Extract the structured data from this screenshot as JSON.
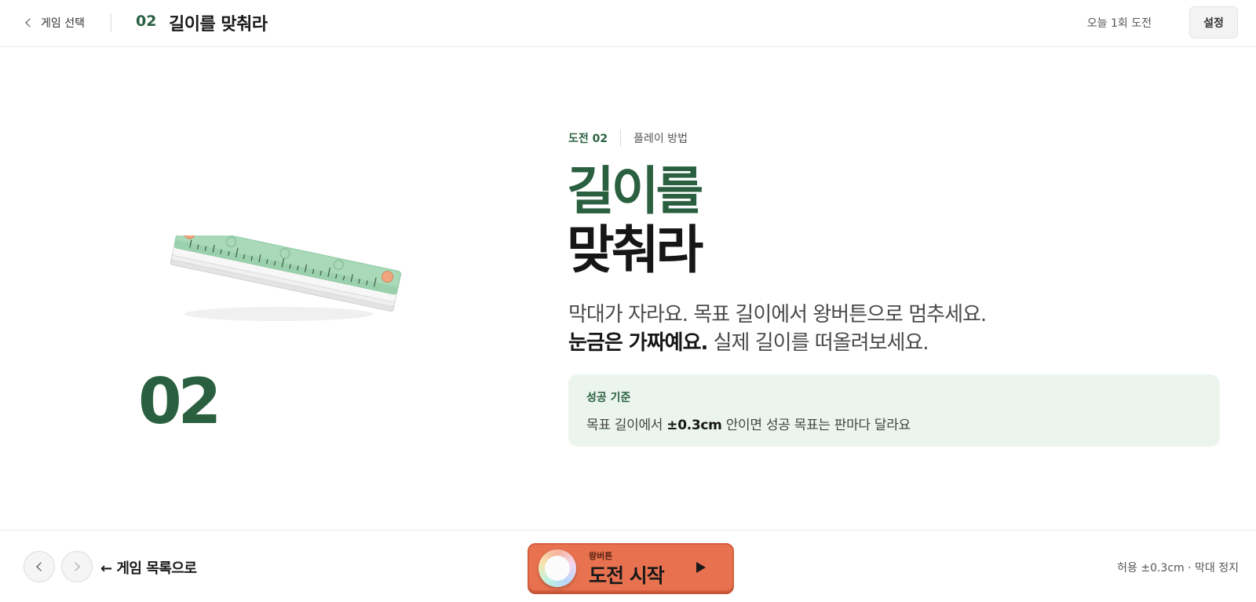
{
  "header": {
    "back_label": "게임 선택",
    "game_number": "02",
    "game_title": "길이를 맞춰라",
    "today_status": "오늘 1회 도전",
    "settings_label": "설정"
  },
  "illustration": {
    "icon": "ruler-icon",
    "number": "02"
  },
  "content": {
    "challenge_label": "도전 02",
    "howto_label": "플레이 방법",
    "title_line1": "길이를",
    "title_line2": "맞춰라",
    "desc_line1": "막대가 자라요. 목표 길이에서 왕버튼으로 멈추세요.",
    "desc_line2_bold": "눈금은 가짜예요.",
    "desc_line2_rest": " 실제 길이를 떠올려보세요."
  },
  "criteria": {
    "label": "성공 기준",
    "text_pre": "목표 길이에서 ",
    "text_bold": "±0.3cm",
    "text_post": " 안이면 성공 목표는 판마다 달라요"
  },
  "footer": {
    "prev_icon": "chevron-left-icon",
    "next_icon": "chevron-right-icon",
    "back_to_list": "← 게임 목록으로",
    "start_small": "왕버튼",
    "start_label": "도전 시작",
    "status": "허용 ±0.3cm · 막대 정지"
  },
  "colors": {
    "accent_green": "#2a6040",
    "start_orange": "#e8724f",
    "criteria_bg": "#ebf5ed"
  }
}
